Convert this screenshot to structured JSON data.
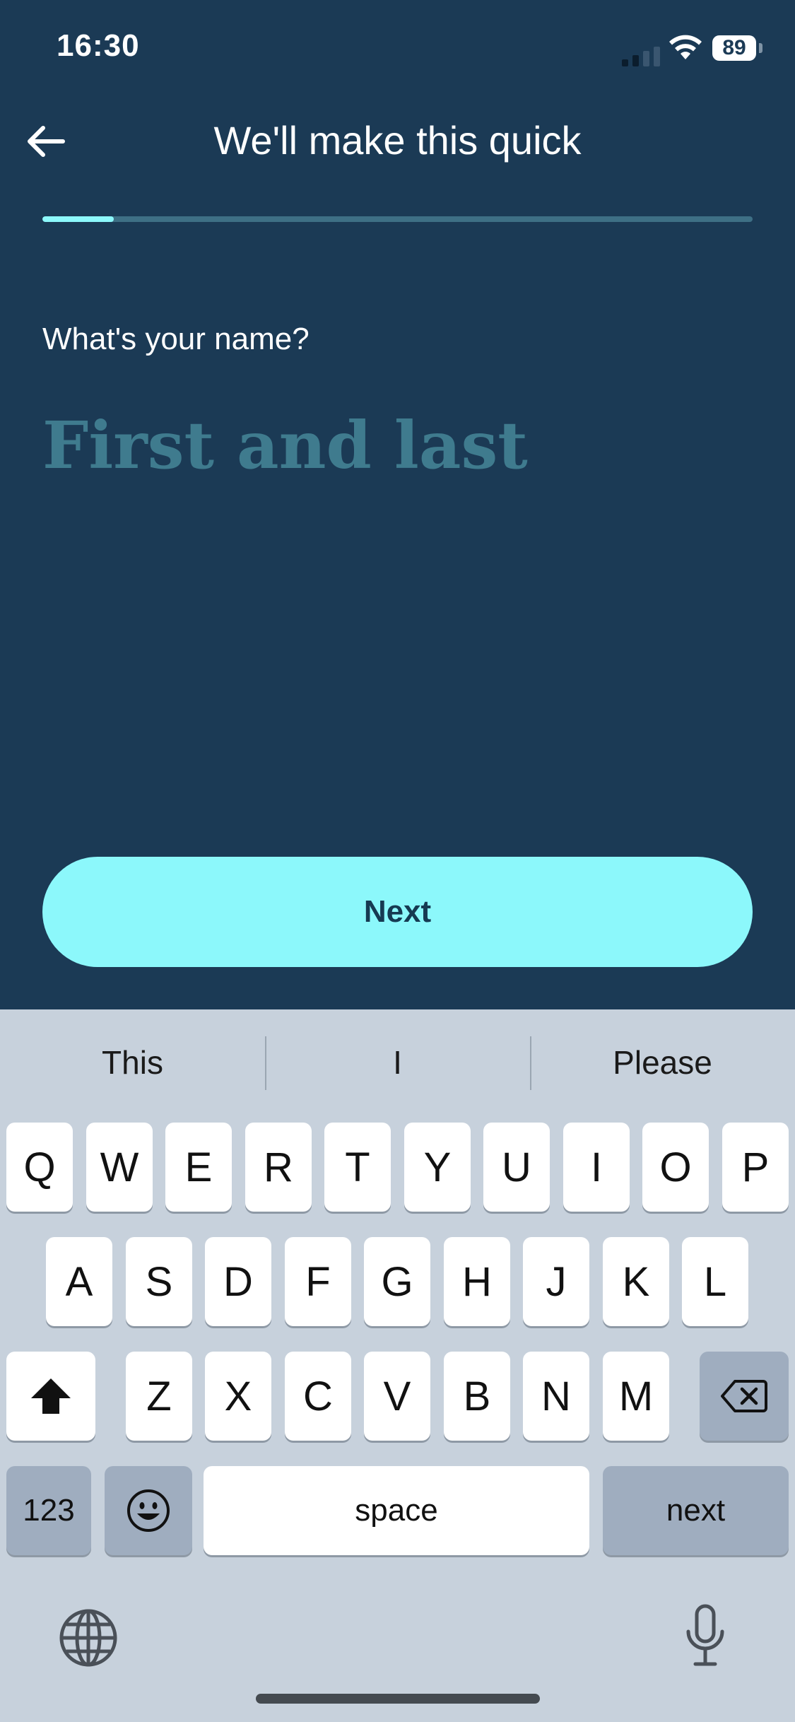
{
  "status_bar": {
    "time": "16:30",
    "battery": "89"
  },
  "header": {
    "title": "We'll make this quick"
  },
  "progress": {
    "fraction": 0.1
  },
  "form": {
    "question": "What's your name?",
    "placeholder": "First and last"
  },
  "cta": {
    "label": "Next"
  },
  "colors": {
    "background": "#1b3a55",
    "accent": "#8cf8fb",
    "placeholder": "#3f7b8e",
    "track": "#3e6f85",
    "keyboard": "#c7d1dc"
  },
  "keyboard": {
    "suggestions": [
      "This",
      "I",
      "Please"
    ],
    "row1": [
      "Q",
      "W",
      "E",
      "R",
      "T",
      "Y",
      "U",
      "I",
      "O",
      "P"
    ],
    "row2": [
      "A",
      "S",
      "D",
      "F",
      "G",
      "H",
      "J",
      "K",
      "L"
    ],
    "row3": [
      "Z",
      "X",
      "C",
      "V",
      "B",
      "N",
      "M"
    ],
    "numbers_label": "123",
    "space_label": "space",
    "return_label": "next",
    "icons": {
      "shift": "shift-icon",
      "delete": "backspace-icon",
      "emoji": "emoji-icon",
      "globe": "globe-icon",
      "mic": "microphone-icon"
    }
  }
}
